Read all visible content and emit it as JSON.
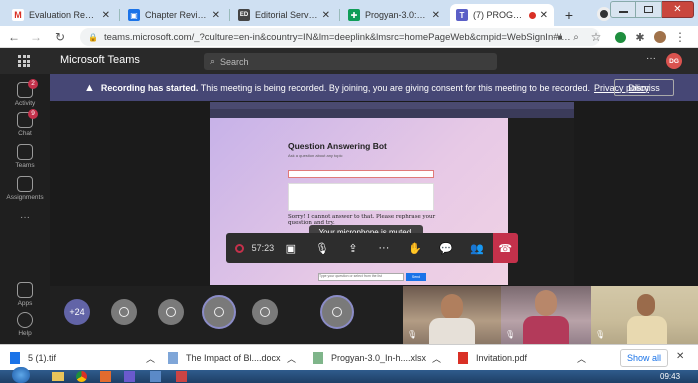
{
  "browser": {
    "tabs": [
      {
        "label": "Evaluation Remindè",
        "favicon": "gmail-icon",
        "active": false
      },
      {
        "label": "Chapter Review Forr",
        "favicon": "docs-icon",
        "active": false
      },
      {
        "label": "Editorial Service Par",
        "favicon": "editorial-icon",
        "active": false
      },
      {
        "label": "Progyan-3.0: In-hou",
        "favicon": "sheets-icon",
        "active": false
      },
      {
        "label": "(7) PROGYAN 3",
        "favicon": "teams-icon",
        "active": true
      }
    ],
    "new_tab_symbol": "+",
    "url": "teams.microsoft.com/_?culture=en-in&country=IN&lm=deeplink&lmsrc=homePageWeb&cmpid=WebSignIn#/pr..."
  },
  "teams": {
    "app_name": "Microsoft Teams",
    "search_placeholder": "Search",
    "more_symbol": "···",
    "avatar_initials": "DG",
    "rail": [
      {
        "label": "Activity",
        "badge": "2"
      },
      {
        "label": "Chat",
        "badge": "9"
      },
      {
        "label": "Teams",
        "badge": ""
      },
      {
        "label": "Assignments",
        "badge": ""
      },
      {
        "label": "···",
        "badge": ""
      },
      {
        "label": "Apps",
        "badge": ""
      },
      {
        "label": "Help",
        "badge": ""
      }
    ]
  },
  "banner": {
    "bold": "Recording has started.",
    "text": " This meeting is being recorded. By joining, you are giving consent for this meeting to be recorded.",
    "link": "Privacy policy",
    "dismiss": "Dismiss"
  },
  "shared_screen": {
    "title": "Question Answering Bot",
    "subtitle": "Ask a question about any topic",
    "reply": "Sorry! I cannot answer to that. Please rephrase your question and try.",
    "bottom_input_placeholder": "Type your question or select from the list",
    "bottom_button": "Send",
    "mic_toast": "Your microphone is muted."
  },
  "meeting": {
    "timer": "57:23",
    "more_participants": "+24"
  },
  "downloads": {
    "items": [
      "5 (1).tif",
      "The Impact of Bl....docx",
      "Progyan-3.0_In-h....xlsx",
      "Invitation.pdf"
    ],
    "show_all": "Show all"
  },
  "taskbar": {
    "clock": "09:43"
  }
}
